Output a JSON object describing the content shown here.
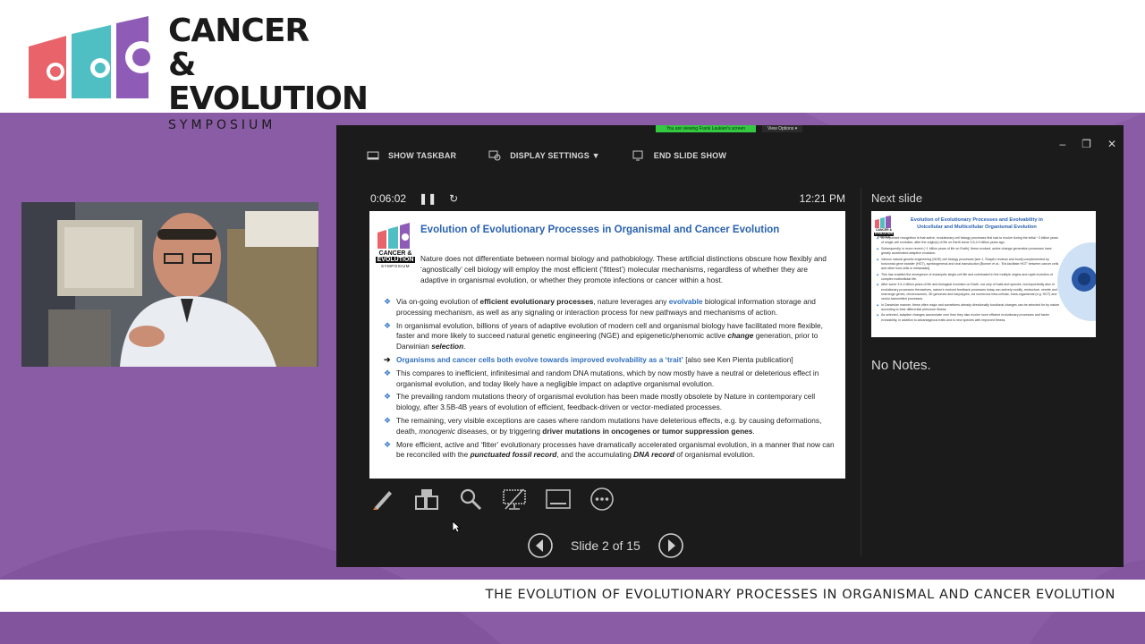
{
  "header": {
    "logo_line1": "CANCER &",
    "logo_line2": "EVOLUTION",
    "logo_line3": "SYMPOSIUM",
    "brand_colors": {
      "coral": "#e8636a",
      "teal": "#4fbfc4",
      "purple": "#8e5bb6"
    }
  },
  "screen_share": {
    "banner": "You are viewing Frank Laukien's screen",
    "view_options": "View Options ▾"
  },
  "toolbar": {
    "show_taskbar": "SHOW TASKBAR",
    "display_settings": "DISPLAY SETTINGS ▼",
    "end_slide_show": "END SLIDE SHOW"
  },
  "presenter": {
    "elapsed": "0:06:02",
    "clock": "12:21 PM",
    "next_slide_label": "Next slide",
    "notes": "No Notes.",
    "slide_counter": "Slide 2 of 15"
  },
  "current_slide": {
    "logo_text_1": "CANCER &",
    "logo_text_2": "EVOLUTION",
    "logo_text_3": "SYMPOSIUM",
    "title": "Evolution of Evolutionary Processes in Organismal and Cancer Evolution",
    "intro": "Nature does not differentiate between normal biology and pathobiology. These artificial distinctions obscure how flexibly and ‘agnostically’ cell biology will employ the most efficient (‘fittest’) molecular mechanisms, regardless of whether they are adaptive in organismal evolution, or whether they promote infections or cancer within a host.",
    "b1_a": "Via on-going evolution of ",
    "b1_b": "efficient evolutionary processes",
    "b1_c": ", nature leverages any ",
    "b1_d": "evolvable",
    "b1_e": " biological information storage and processing mechanism, as well as any signaling or interaction process for new pathways and mechanisms of action.",
    "b2_a": "In organismal evolution, billions of years of adaptive evolution of modern cell and organismal biology have facilitated more flexible, faster and more likely to succeed natural genetic engineering (NGE) and epigenetic/phenomic active ",
    "b2_b": "change",
    "b2_c": " generation, prior to Darwinian ",
    "b2_d": "selection",
    "b2_e": ".",
    "b3_a": "Organisms and cancer cells both evolve towards improved evolvability as a ‘trait’",
    "b3_b": " [also see Ken Pienta publication]",
    "b4": "This compares to inefficient, infinitesimal and random DNA mutations, which by now mostly have a neutral or deleterious effect in organismal evolution, and today likely have a negligible impact on adaptive organismal evolution.",
    "b5": "The prevailing random mutations theory of organismal evolution has been made mostly obsolete by Nature in contemporary cell biology, after 3.5B-4B years of evolution of efficient, feedback-driven or vector-mediated processes.",
    "b6_a": "The remaining, very visible exceptions are cases where random mutations have deleterious effects, e.g. by causing deformations, death, ",
    "b6_b": "monogenic",
    "b6_c": " diseases, or by triggering ",
    "b6_d": "driver mutations in oncogenes or tumor suppression genes",
    "b6_e": ".",
    "b7_a": "More efficient, active and ‘fitter’ evolutionary processes have dramatically accelerated organismal evolution, in a manner that now can be reconciled with the ",
    "b7_b": "punctuated fossil record",
    "b7_c": ", and the accumulating ",
    "b7_d": "DNA record",
    "b7_e": " of organismal evolution."
  },
  "next_slide": {
    "logo_text_1": "CANCER &",
    "logo_text_2": "EVOLUTION",
    "logo_text_3": "SYMPOSIUM",
    "title": "Evolution of Evolutionary Processes and Evolvability in Unicellular and Multicellular Organismal Evolution",
    "bullets": [
      "An important recognition is that active, evolutionary cell biology processes first had to evolve during the initial ~3 billion years of single-cell evolution, after the origin(s) of life on Earth some 3.5-4.0 billion years ago.",
      "Subsequently, in more recent (~1 billion years of life on Earth), these evolved, active change generation processes have greatly accelerated adaptive evolution.",
      "Various natural genetic engineering (NGE) cell biology processes [see J. Shapiro reviews and book] complemented by horizontal gene transfer (HGT), symbiogenesis and viral transduction [Bonner et al.: 'Ent-facilitate HGT' between cancer cells and other host cells in metastasis]",
      "This has enabled the emergence of eukaryotic single-cell life and culminated in the multiple origins and rapid evolution of complex multicellular life.",
      "After some 3.5-4 billion years of life and biological evolution on Earth, not only of traits and species, but importantly also of evolutionary processes themselves, nature's evolved feedback processes today can actively modify, restructure, rewrite and rearrange genes, chromosomes, 3D genomes and karyotypes, via numerous intra-cellular, trans-organismal (e.g. HGT) and vector-transmitted processes.",
      "In Darwinian manner, these often major and sometimes already directionally functional changes can be selected for by nature according to their differential phenome fitness.",
      "As selected, adaptive changes accumulate over time they also evolve more efficient evolutionary processes and faster evolvability, in addition to advantageous traits and to new species with improved fitness."
    ]
  },
  "caption": "THE EVOLUTION OF EVOLUTIONARY PROCESSES IN ORGANISMAL AND CANCER EVOLUTION"
}
